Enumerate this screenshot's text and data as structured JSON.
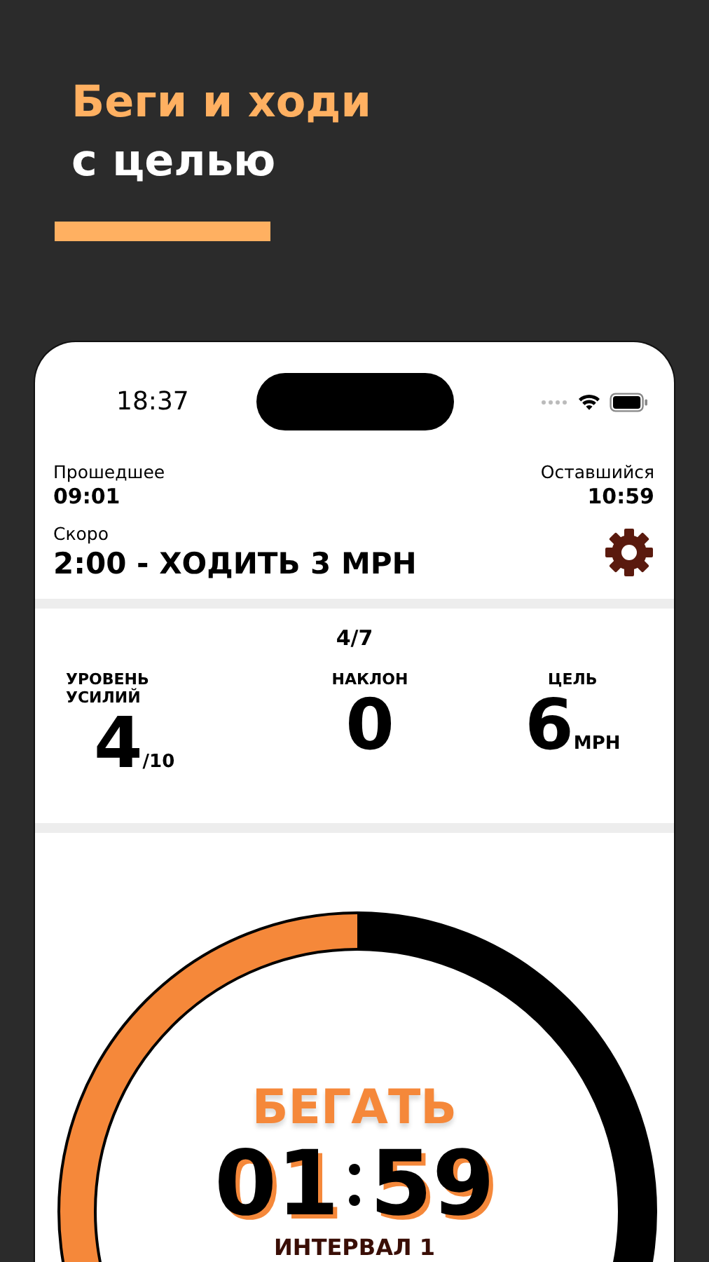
{
  "headline": {
    "line_1": "Беги и ходи",
    "line_2": "с целью"
  },
  "status_bar": {
    "time": "18:37"
  },
  "elapsed": {
    "label": "Прошедшее",
    "value": "09:01"
  },
  "remaining": {
    "label": "Оставшийся",
    "value": "10:59"
  },
  "next": {
    "label": "Скоро",
    "value": "2:00 - ХОДИТЬ 3 MPH"
  },
  "interval_count": "4/7",
  "stats": [
    {
      "label": "УРОВЕНЬ УСИЛИЙ",
      "value": "4",
      "unit": "/10"
    },
    {
      "label": "НАКЛОН",
      "value": "0"
    },
    {
      "label": "ЦЕЛЬ",
      "value": "6",
      "unit": "MPH"
    }
  ],
  "timer": {
    "phase": "БЕГАТЬ",
    "minutes": "01",
    "seconds": "59",
    "interval": "ИНТЕРВАЛ 1"
  }
}
